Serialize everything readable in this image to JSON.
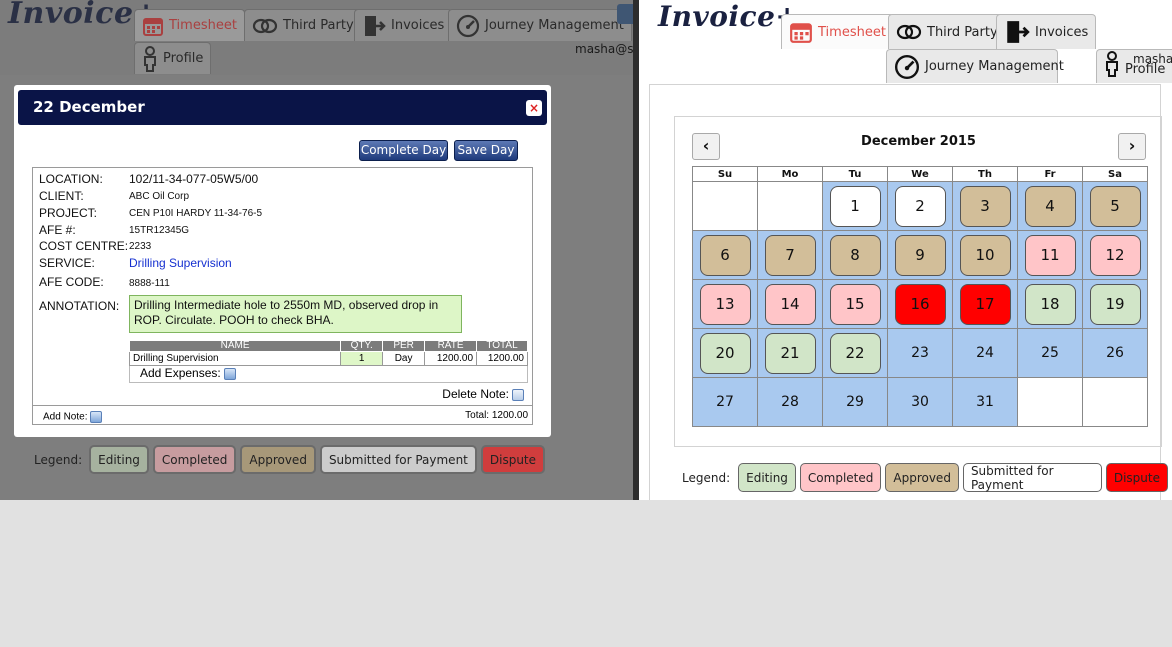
{
  "app": {
    "logo": "Invoice+"
  },
  "tabs": {
    "timesheet": "Timesheet",
    "third_party": "Third Party",
    "invoices": "Invoices",
    "journey": "Journey Management",
    "profile": "Profile"
  },
  "user": {
    "left": "masha@s",
    "right": "masha@"
  },
  "modal": {
    "title": "22 December",
    "close": "×",
    "complete_day": "Complete Day",
    "save_day": "Save Day",
    "fields": {
      "location_label": "LOCATION:",
      "location": "102/11-34-077-05W5/00",
      "client_label": "CLIENT:",
      "client": "ABC Oil Corp",
      "project_label": "PROJECT:",
      "project": "CEN P10I HARDY 11-34-76-5",
      "afe_label": "AFE #:",
      "afe": "15TR12345G",
      "cost_centre_label": "COST CENTRE:",
      "cost_centre": "2233",
      "service_label": "SERVICE:",
      "service": "Drilling Supervision",
      "afe_code_label": "AFE CODE:",
      "afe_code": "8888-111",
      "annotation_label": "ANNOTATION:",
      "annotation": "Drilling Intermediate hole to 2550m MD, observed drop in ROP. Circulate. POOH to check BHA."
    },
    "expenses": {
      "headers": [
        "NAME",
        "QTY.",
        "PER",
        "RATE",
        "TOTAL"
      ],
      "rows": [
        {
          "name": "Drilling Supervision",
          "qty": "1",
          "per": "Day",
          "rate": "1200.00",
          "total": "1200.00"
        }
      ],
      "add_label": "Add Expenses:"
    },
    "delete_note": "Delete Note:",
    "add_note": "Add Note:",
    "total": "Total: 1200.00"
  },
  "legend": {
    "label": "Legend:",
    "items": [
      "Editing",
      "Completed",
      "Approved",
      "Submitted for Payment",
      "Dispute"
    ]
  },
  "calendar": {
    "title": "December 2015",
    "prev": "‹",
    "next": "›",
    "weekdays": [
      "Su",
      "Mo",
      "Tu",
      "We",
      "Th",
      "Fr",
      "Sa"
    ],
    "weeks": [
      [
        null,
        null,
        {
          "d": "1",
          "s": "submitted"
        },
        {
          "d": "2",
          "s": "submitted"
        },
        {
          "d": "3",
          "s": "approved"
        },
        {
          "d": "4",
          "s": "approved"
        },
        {
          "d": "5",
          "s": "approved"
        }
      ],
      [
        {
          "d": "6",
          "s": "approved"
        },
        {
          "d": "7",
          "s": "approved"
        },
        {
          "d": "8",
          "s": "approved"
        },
        {
          "d": "9",
          "s": "approved"
        },
        {
          "d": "10",
          "s": "approved"
        },
        {
          "d": "11",
          "s": "completed"
        },
        {
          "d": "12",
          "s": "completed"
        }
      ],
      [
        {
          "d": "13",
          "s": "completed"
        },
        {
          "d": "14",
          "s": "completed"
        },
        {
          "d": "15",
          "s": "completed"
        },
        {
          "d": "16",
          "s": "dispute"
        },
        {
          "d": "17",
          "s": "dispute"
        },
        {
          "d": "18",
          "s": "editing"
        },
        {
          "d": "19",
          "s": "editing"
        }
      ],
      [
        {
          "d": "20",
          "s": "editing"
        },
        {
          "d": "21",
          "s": "editing"
        },
        {
          "d": "22",
          "s": "editing"
        },
        {
          "d": "23",
          "s": ""
        },
        {
          "d": "24",
          "s": ""
        },
        {
          "d": "25",
          "s": ""
        },
        {
          "d": "26",
          "s": ""
        }
      ],
      [
        {
          "d": "27",
          "s": ""
        },
        {
          "d": "28",
          "s": ""
        },
        {
          "d": "29",
          "s": ""
        },
        {
          "d": "30",
          "s": ""
        },
        {
          "d": "31",
          "s": ""
        },
        null,
        null
      ]
    ]
  },
  "colors": {
    "editing": "#d1e5c8",
    "completed": "#ffc5c8",
    "approved": "#d2be99",
    "submitted": "#ffffff",
    "dispute": "#ff0000",
    "shaded_cell": "#a9c9ef",
    "modal_header": "#0a1447"
  }
}
